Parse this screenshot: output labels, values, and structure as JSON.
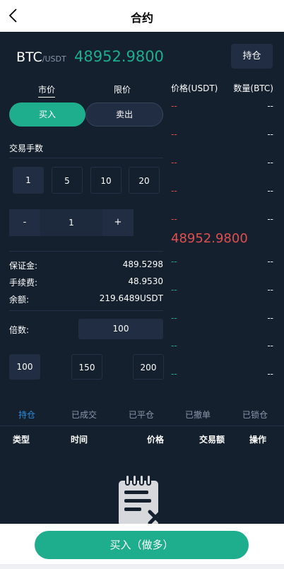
{
  "header": {
    "title": "合约",
    "back_icon": "back-arrow-icon"
  },
  "pair": {
    "base": "BTC",
    "quote": "/USDT",
    "price": "48952.9800",
    "hold_label": "持仓"
  },
  "order": {
    "tab_market": "市价",
    "tab_limit": "限价",
    "buy_label": "买入",
    "sell_label": "卖出",
    "qty_label": "交易手数",
    "quick": [
      "1",
      "5",
      "10",
      "20"
    ],
    "stepper": {
      "minus": "-",
      "value": "1",
      "plus": "+"
    },
    "margin_label": "保证金:",
    "margin_value": "489.5298",
    "fee_label": "手续费:",
    "fee_value": "48.9530",
    "balance_label": "余额:",
    "balance_value": "219.6489USDT",
    "leverage_label": "倍数:",
    "leverage_value": "100",
    "leverage_options": [
      "100",
      "150",
      "200"
    ]
  },
  "orderbook": {
    "price_header": "价格(USDT)",
    "qty_header": "数量(BTC)",
    "asks": [
      {
        "p": "--",
        "q": "--"
      },
      {
        "p": "--",
        "q": "--"
      },
      {
        "p": "--",
        "q": "--"
      },
      {
        "p": "--",
        "q": "--"
      },
      {
        "p": "--",
        "q": "--"
      }
    ],
    "last_price": "48952.9800",
    "bids": [
      {
        "p": "--",
        "q": "--"
      },
      {
        "p": "--",
        "q": "--"
      },
      {
        "p": "--",
        "q": "--"
      },
      {
        "p": "--",
        "q": "--"
      },
      {
        "p": "--",
        "q": "--"
      }
    ]
  },
  "orders": {
    "tabs": [
      "持仓",
      "已成交",
      "已平仓",
      "已撤单",
      "已锁仓"
    ],
    "columns": [
      "类型",
      "时间",
      "价格",
      "交易额",
      "操作"
    ],
    "empty_icon": "empty-list-icon"
  },
  "footer": {
    "long_label": "买入（做多）"
  },
  "colors": {
    "bg": "#14202e",
    "green": "#1ead8d",
    "red": "#e04f4f",
    "blue": "#2a8bd8"
  }
}
